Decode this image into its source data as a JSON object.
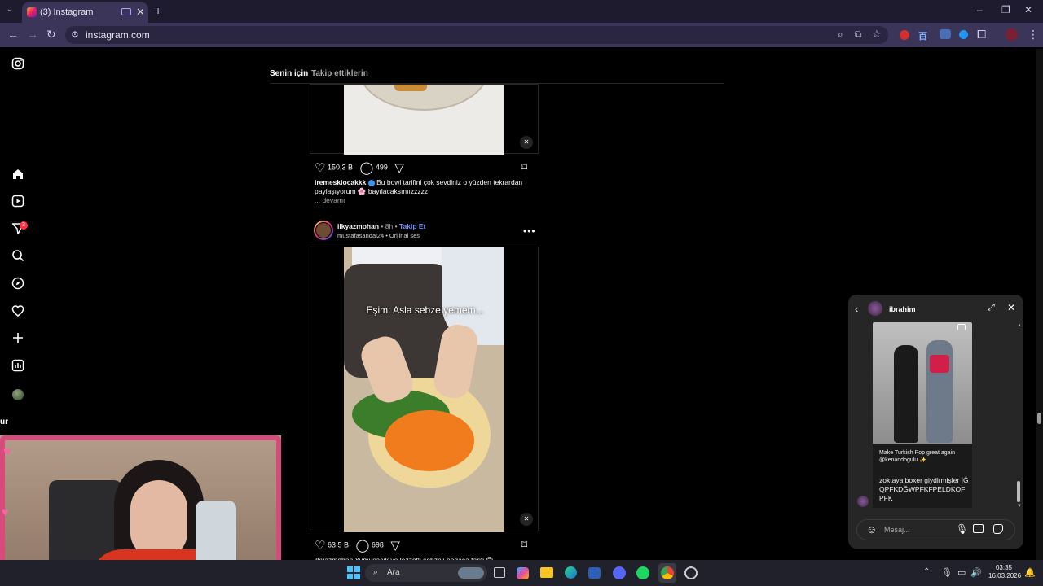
{
  "browser": {
    "tab_title": "(3) Instagram",
    "url": "instagram.com"
  },
  "sidebar": {
    "items": [
      {
        "name": "instagram-logo-icon"
      },
      {
        "name": "home-icon"
      },
      {
        "name": "reels-icon"
      },
      {
        "name": "messages-icon",
        "badge": "3"
      },
      {
        "name": "search-icon"
      },
      {
        "name": "explore-icon"
      },
      {
        "name": "notifications-icon"
      },
      {
        "name": "create-icon"
      },
      {
        "name": "dashboard-icon"
      },
      {
        "name": "profile-avatar-icon"
      }
    ],
    "partial_label": "ur"
  },
  "feed": {
    "tabs": [
      {
        "label": "Senin için",
        "active": true
      },
      {
        "label": "Takip ettiklerin",
        "active": false
      }
    ],
    "post1": {
      "likes": "150,3 B",
      "comments": "499",
      "username": "iremeskiocakkk",
      "caption": "Bu bowl tarifini çok sevdiniz o yüzden tekrardan paylaşıyorum 🌸 bayılacaksınıızzzzz",
      "more": "... devamı"
    },
    "post2": {
      "username": "ilkyazmohan",
      "time": "8h",
      "follow": "Takip Et",
      "audio": "mustafasandal24 • Orijinal ses",
      "overlay_text": "Eşim: Asla sebze yemem...",
      "likes": "63,5 B",
      "comments": "698",
      "caption_peek": "ilkyazmohan Yumuşacık ve lezzetli sebzeli poğaça tarifi 😋"
    }
  },
  "dm": {
    "contact": "ibrahim",
    "message1": "Make Turkish Pop great again @kenandogulu ✨",
    "message2": "zoktaya boxer giydirmişler İĞQPFKDĞWPFKFPELDKOFPFK",
    "input_placeholder": "Mesaj..."
  },
  "taskbar": {
    "search_placeholder": "Ara",
    "time": "03:35",
    "date": "16.03.2026"
  },
  "colors": {
    "chrome_dark": "#1f1b2e",
    "chrome_light": "#3b355a",
    "follow_blue": "#708dff",
    "badge_red": "#ff3040"
  }
}
